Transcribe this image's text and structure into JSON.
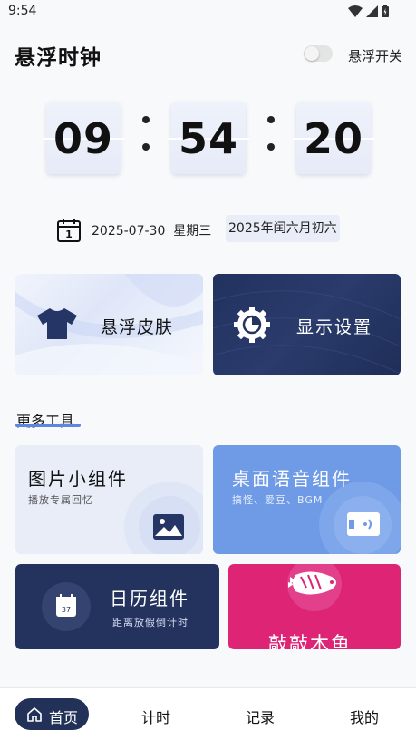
{
  "status_bar": {
    "time": "9:54"
  },
  "header": {
    "title": "悬浮时钟",
    "toggle_label": "悬浮开关",
    "toggle_on": false
  },
  "clock": {
    "hours": "09",
    "minutes": "54",
    "seconds": "20"
  },
  "date": {
    "date": "2025-07-30",
    "weekday": "星期三",
    "lunar": "2025年闰六月初六",
    "calendar_day": "1"
  },
  "features": {
    "skin": {
      "label": "悬浮皮肤",
      "icon": "tshirt-icon"
    },
    "display": {
      "label": "显示设置",
      "icon": "gear-pie-icon"
    }
  },
  "more_tools": {
    "title": "更多工具",
    "items": [
      {
        "title": "图片小组件",
        "subtitle": "播放专属回忆",
        "icon": "image-icon"
      },
      {
        "title": "桌面语音组件",
        "subtitle": "搞怪、爱豆、BGM",
        "icon": "voice-icon"
      },
      {
        "title": "日历组件",
        "subtitle": "距离放假倒计时",
        "icon": "calendar-icon",
        "icon_text": "37"
      },
      {
        "title": "敲敲木鱼",
        "icon": "wooden-fish-icon"
      }
    ]
  },
  "bottom_nav": {
    "items": [
      {
        "label": "首页",
        "active": true
      },
      {
        "label": "计时"
      },
      {
        "label": "记录"
      },
      {
        "label": "我的"
      }
    ]
  },
  "colors": {
    "navy": "#223158",
    "accent_blue": "#5b87e0",
    "voice_blue": "#6f9be6",
    "fish_pink": "#dd2475"
  }
}
